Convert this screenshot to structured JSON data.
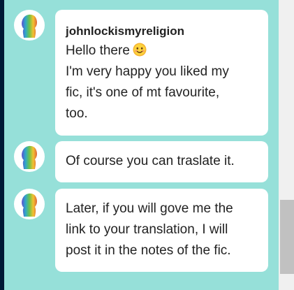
{
  "messages": [
    {
      "author": "johnlockismyreligion",
      "lines": [
        "Hello there",
        "I'm very happy you liked my",
        "fic, it's one of mt favourite,",
        "too."
      ],
      "emoji": "smiling-face-emoji"
    },
    {
      "lines": [
        "Of course you can traslate it."
      ]
    },
    {
      "lines": [
        "Later, if you will gove me the",
        "link to your translation, I will",
        "post it in the notes of the fic."
      ]
    }
  ],
  "colors": {
    "background": "#96e0d9",
    "bubble": "#ffffff",
    "text": "#222222",
    "sidebar": "#001935"
  },
  "icons": {
    "avatar": "rainbow-silhouette-avatar",
    "emoji": "smiling-face-icon"
  }
}
